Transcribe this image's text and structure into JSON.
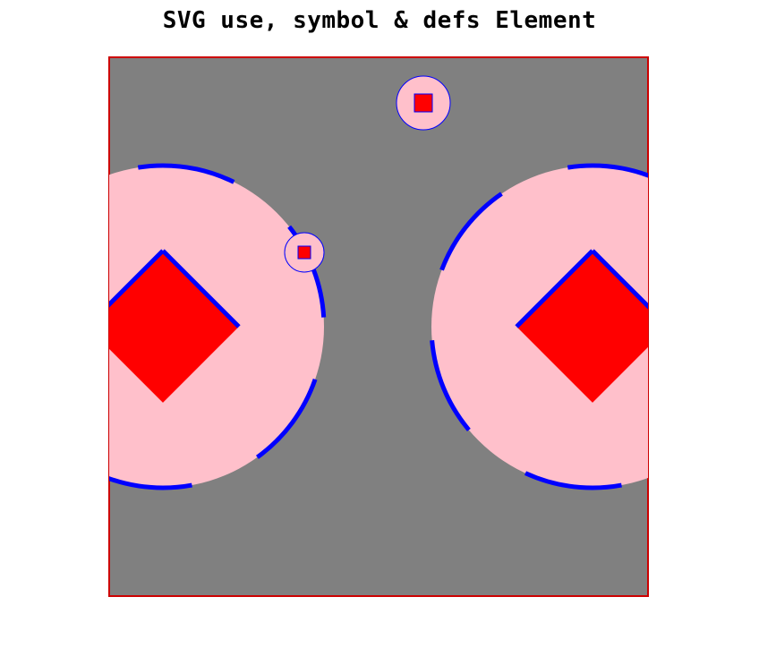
{
  "header": {
    "title": "SVG use, symbol & defs Element"
  },
  "colors": {
    "canvas_background": "#808080",
    "canvas_border": "#cc0000",
    "circle_fill": "#ffc0cb",
    "circle_stroke": "#0000ff",
    "square_fill": "#ff0000",
    "square_stroke": "#0000ff"
  },
  "scene": {
    "symbol": "circle-with-square",
    "instances": [
      {
        "name": "large-left",
        "dashed_outline": true,
        "rotated_square": true
      },
      {
        "name": "large-right",
        "dashed_outline": true,
        "rotated_square": true
      },
      {
        "name": "small-top",
        "dashed_outline": false,
        "rotated_square": false
      },
      {
        "name": "small-middle",
        "dashed_outline": false,
        "rotated_square": false
      }
    ]
  }
}
